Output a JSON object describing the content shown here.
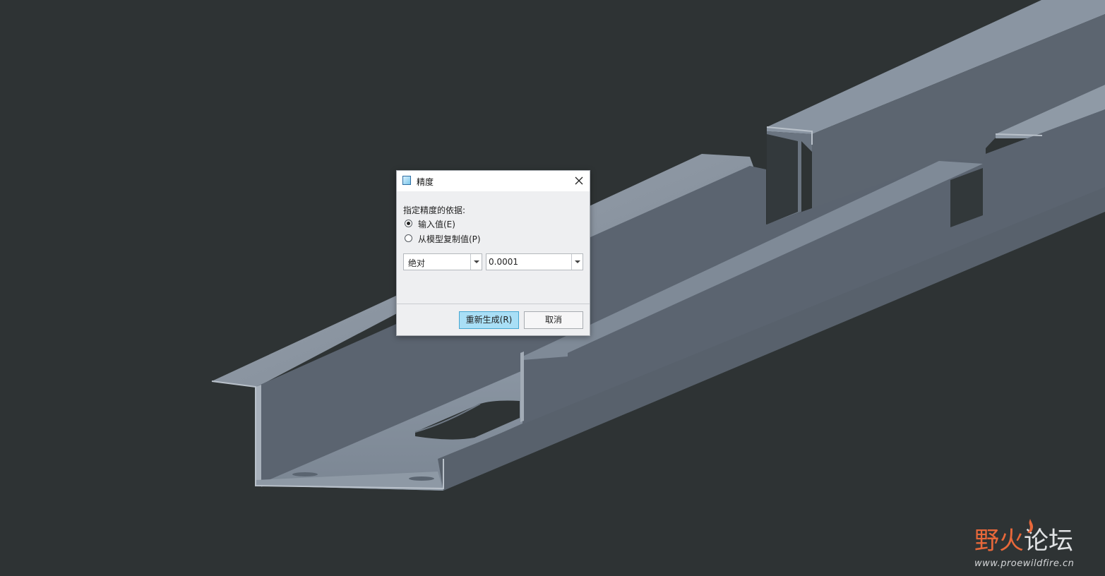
{
  "dialog": {
    "title": "精度",
    "basis_label": "指定精度的依据:",
    "radio_options": [
      {
        "label": "输入值(E)",
        "selected": true
      },
      {
        "label": "从模型复制值(P)",
        "selected": false
      }
    ],
    "mode_select": {
      "value": "绝对"
    },
    "value_select": {
      "value": "0.0001"
    },
    "regenerate_button": "重新生成(R)",
    "cancel_button": "取消"
  },
  "watermark": {
    "name_part1": "野火",
    "name_part2": "论坛",
    "url": "www.proewildfire.cn"
  },
  "colors": {
    "background": "#2e3334",
    "accent_button": "#a9dff6",
    "model_light": "#86919e",
    "model_dark": "#57606b"
  },
  "icons": [
    "dialog-app-icon",
    "close-icon",
    "dropdown-arrow-icon",
    "flame-icon"
  ]
}
